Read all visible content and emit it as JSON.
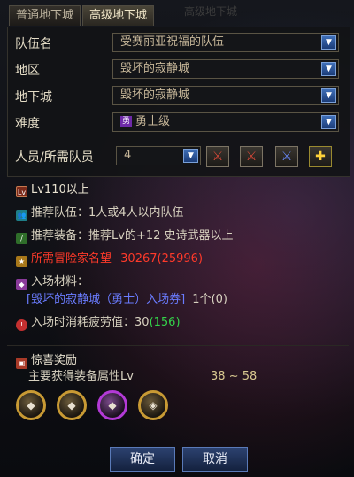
{
  "tabs": [
    "普通地下城",
    "高级地下城"
  ],
  "faded_title": "高级地下城",
  "form": {
    "team_label": "队伍名",
    "team_value": "受赛丽亚祝福的队伍",
    "region_label": "地区",
    "region_value": "毁坏的寂静城",
    "dungeon_label": "地下城",
    "dungeon_value": "毁坏的寂静城",
    "difficulty_label": "难度",
    "difficulty_icon": "勇",
    "difficulty_value": "勇士级",
    "members_label": "人员/所需队员",
    "members_value": "4"
  },
  "info": {
    "level": "Lv110以上",
    "team_prefix": "推荐队伍：",
    "team_text": "1人或4人以内队伍",
    "equip_prefix": "推荐装备：",
    "equip_text": "推荐Lv的+12 史诗武器以上",
    "fame_label": "所需冒险家名望",
    "fame_value": "30267",
    "fame_extra": "(25996)",
    "material_label": "入场材料：",
    "material_item": "[毁坏的寂静城（勇士）入场券]",
    "material_count": "1个(0)",
    "fatigue_label": "入场时消耗疲劳值：",
    "fatigue_value": "30",
    "fatigue_extra": "(156)"
  },
  "reward": {
    "title": "惊喜奖励",
    "desc": "主要获得装备属性Lv",
    "range": "38 ~ 58"
  },
  "buttons": {
    "confirm": "确定",
    "cancel": "取消"
  }
}
